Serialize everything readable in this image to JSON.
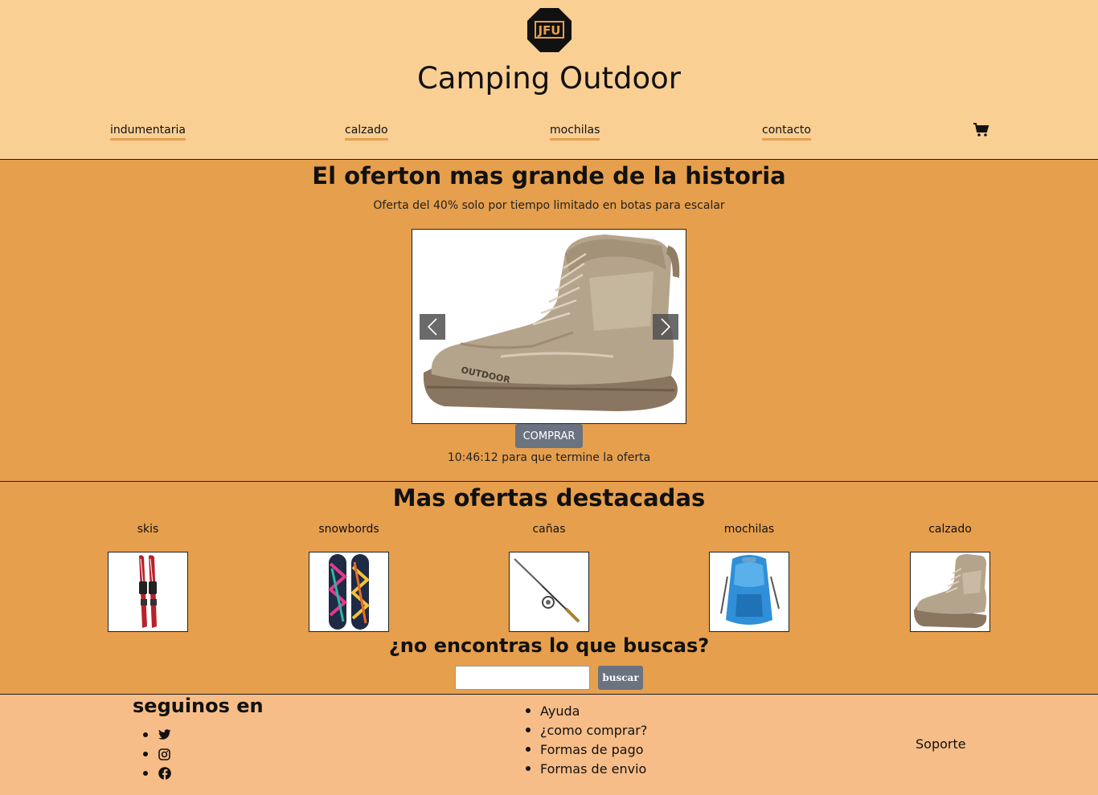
{
  "header": {
    "site_title": "Camping Outdoor",
    "logo_text": "JFU",
    "nav": [
      "indumentaria",
      "calzado",
      "mochilas",
      "contacto"
    ]
  },
  "hero": {
    "title": "El oferton mas grande de la historia",
    "subtitle": "Oferta del 40% solo por tiempo limitado en botas para escalar",
    "boot_brand": "OUTDOOR",
    "buy_label": "COMPRAR",
    "countdown": "10:46:12 para que termine la oferta"
  },
  "offers": {
    "title": "Mas ofertas destacadas",
    "items": [
      "skis",
      "snowbords",
      "cañas",
      "mochilas",
      "calzado"
    ]
  },
  "search": {
    "title": "¿no encontras lo que buscas?",
    "value": "",
    "button_label": "buscar"
  },
  "footer": {
    "follow_title": "seguinos en",
    "social": [
      "twitter-icon",
      "instagram-icon",
      "facebook-icon"
    ],
    "links": [
      "Ayuda",
      "¿como comprar?",
      "Formas de pago",
      "Formas de envio"
    ],
    "support": "Soporte"
  },
  "colors": {
    "header_bg": "#f9cf94",
    "main_bg": "#e69f4d",
    "footer_bg": "#f7bd88",
    "button": "#6b7280"
  }
}
